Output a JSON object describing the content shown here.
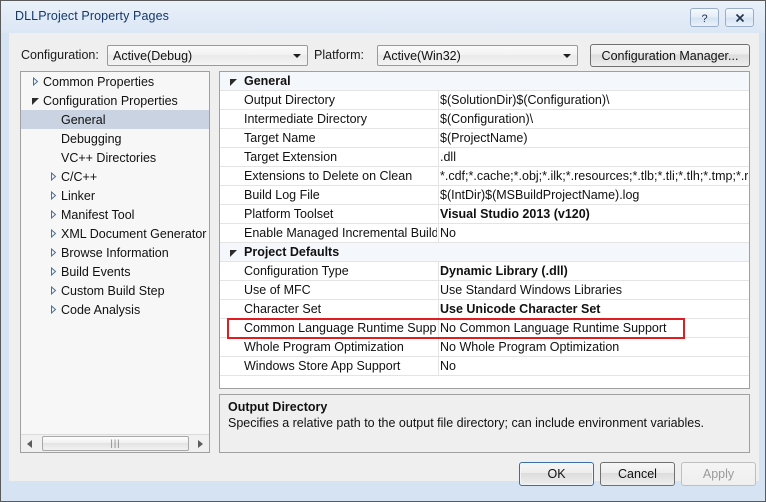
{
  "window": {
    "title": "DLLProject Property Pages",
    "help_button": "?",
    "close_button": "✕"
  },
  "toolbar": {
    "configuration_label": "Configuration:",
    "configuration_value": "Active(Debug)",
    "platform_label": "Platform:",
    "platform_value": "Active(Win32)",
    "configuration_manager_label": "Configuration Manager..."
  },
  "tree": {
    "items": [
      {
        "label": "Common Properties",
        "indent": 0,
        "state": "collapsed",
        "selected": false
      },
      {
        "label": "Configuration Properties",
        "indent": 0,
        "state": "expanded",
        "selected": false
      },
      {
        "label": "General",
        "indent": 1,
        "state": "leaf",
        "selected": true
      },
      {
        "label": "Debugging",
        "indent": 1,
        "state": "leaf",
        "selected": false
      },
      {
        "label": "VC++ Directories",
        "indent": 1,
        "state": "leaf",
        "selected": false
      },
      {
        "label": "C/C++",
        "indent": 1,
        "state": "collapsed",
        "selected": false
      },
      {
        "label": "Linker",
        "indent": 1,
        "state": "collapsed",
        "selected": false
      },
      {
        "label": "Manifest Tool",
        "indent": 1,
        "state": "collapsed",
        "selected": false
      },
      {
        "label": "XML Document Generator",
        "indent": 1,
        "state": "collapsed",
        "selected": false
      },
      {
        "label": "Browse Information",
        "indent": 1,
        "state": "collapsed",
        "selected": false
      },
      {
        "label": "Build Events",
        "indent": 1,
        "state": "collapsed",
        "selected": false
      },
      {
        "label": "Custom Build Step",
        "indent": 1,
        "state": "collapsed",
        "selected": false
      },
      {
        "label": "Code Analysis",
        "indent": 1,
        "state": "collapsed",
        "selected": false
      }
    ],
    "scrollbar": {
      "left_arrow": "◀",
      "right_arrow": "▶",
      "grip": "███"
    }
  },
  "grid": {
    "sections": [
      {
        "name": "General",
        "state": "expanded",
        "rows": [
          {
            "name": "Output Directory",
            "value": "$(SolutionDir)$(Configuration)\\",
            "bold": false,
            "highlighted": false
          },
          {
            "name": "Intermediate Directory",
            "value": "$(Configuration)\\",
            "bold": false,
            "highlighted": false
          },
          {
            "name": "Target Name",
            "value": "$(ProjectName)",
            "bold": false,
            "highlighted": false
          },
          {
            "name": "Target Extension",
            "value": ".dll",
            "bold": false,
            "highlighted": false
          },
          {
            "name": "Extensions to Delete on Clean",
            "value": "*.cdf;*.cache;*.obj;*.ilk;*.resources;*.tlb;*.tli;*.tlh;*.tmp;*.rsp",
            "bold": false,
            "highlighted": false
          },
          {
            "name": "Build Log File",
            "value": "$(IntDir)$(MSBuildProjectName).log",
            "bold": false,
            "highlighted": false
          },
          {
            "name": "Platform Toolset",
            "value": "Visual Studio 2013 (v120)",
            "bold": true,
            "highlighted": false
          },
          {
            "name": "Enable Managed Incremental Build",
            "value": "No",
            "bold": false,
            "highlighted": false
          }
        ]
      },
      {
        "name": "Project Defaults",
        "state": "expanded",
        "rows": [
          {
            "name": "Configuration Type",
            "value": "Dynamic Library (.dll)",
            "bold": true,
            "highlighted": false
          },
          {
            "name": "Use of MFC",
            "value": "Use Standard Windows Libraries",
            "bold": false,
            "highlighted": false
          },
          {
            "name": "Character Set",
            "value": "Use Unicode Character Set",
            "bold": true,
            "highlighted": false
          },
          {
            "name": "Common Language Runtime Support",
            "value": "No Common Language Runtime Support",
            "bold": false,
            "highlighted": true
          },
          {
            "name": "Whole Program Optimization",
            "value": "No Whole Program Optimization",
            "bold": false,
            "highlighted": false
          },
          {
            "name": "Windows Store App Support",
            "value": "No",
            "bold": false,
            "highlighted": false
          }
        ]
      }
    ],
    "highlight_color": "#e31c22"
  },
  "description": {
    "title": "Output Directory",
    "text": "Specifies a relative path to the output file directory; can include environment variables."
  },
  "footer": {
    "ok_label": "OK",
    "cancel_label": "Cancel",
    "apply_label": "Apply"
  }
}
